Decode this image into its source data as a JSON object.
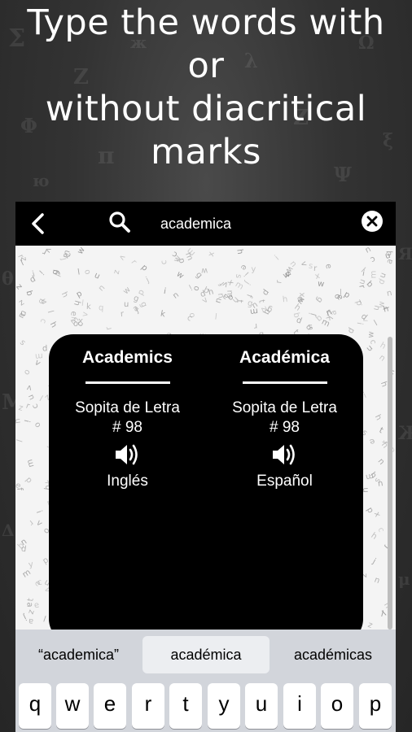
{
  "promo": {
    "line1": "Type the words with",
    "line2": "or",
    "line3": "without diacritical",
    "line4": "marks"
  },
  "search": {
    "back_icon": "chevron-left-icon",
    "search_icon": "magnifier-icon",
    "query": "academica",
    "clear_icon": "close-circle-icon"
  },
  "result_card": {
    "left": {
      "word": "Academics",
      "source": "Sopita de Letra",
      "number": "# 98",
      "speaker_icon": "speaker-icon",
      "language": "Inglés"
    },
    "right": {
      "word": "Académica",
      "source": "Sopita de Letra",
      "number": "# 98",
      "speaker_icon": "speaker-icon",
      "language": "Español"
    }
  },
  "keyboard": {
    "suggestions": [
      "“academica”",
      "académica",
      "académicas"
    ],
    "selected_suggestion": 1,
    "row1": [
      "q",
      "w",
      "e",
      "r",
      "t",
      "y",
      "u",
      "i",
      "o",
      "p"
    ]
  },
  "colors": {
    "card": "#000000",
    "search_bar": "#000000",
    "keyboard_bg": "#d2d5db",
    "selected_suggestion_bg": "#eceef1"
  }
}
